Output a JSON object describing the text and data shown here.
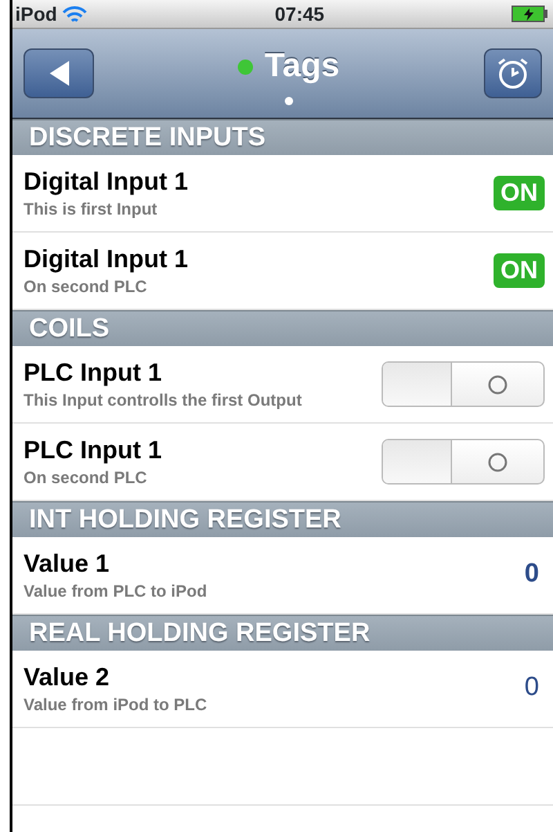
{
  "status_bar": {
    "carrier": "iPod",
    "time": "07:45"
  },
  "nav": {
    "title": "Tags",
    "connected": true
  },
  "sections": [
    {
      "title": "DISCRETE INPUTS",
      "rows": [
        {
          "kind": "indicator",
          "title": "Digital Input 1",
          "subtitle": "This is first Input",
          "on": true,
          "label": "ON"
        },
        {
          "kind": "indicator",
          "title": "Digital Input 1",
          "subtitle": "On second PLC",
          "on": true,
          "label": "ON"
        }
      ]
    },
    {
      "title": "COILS",
      "rows": [
        {
          "kind": "switch",
          "title": "PLC Input 1",
          "subtitle": "This Input controlls the first Output",
          "on": false
        },
        {
          "kind": "switch",
          "title": "PLC Input 1",
          "subtitle": "On second PLC",
          "on": false
        }
      ]
    },
    {
      "title": "INT HOLDING REGISTER",
      "rows": [
        {
          "kind": "readout",
          "title": "Value 1",
          "subtitle": "Value from PLC to iPod",
          "value": "0"
        }
      ]
    },
    {
      "title": "REAL HOLDING REGISTER",
      "rows": [
        {
          "kind": "input",
          "title": "Value 2",
          "subtitle": "Value from iPod to PLC",
          "value": "0"
        }
      ]
    }
  ]
}
